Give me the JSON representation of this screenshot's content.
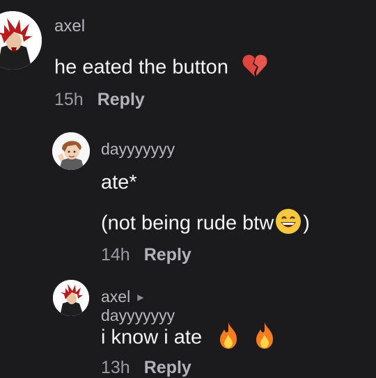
{
  "comments": [
    {
      "username": "axel",
      "text": "he eated the button",
      "emoji": "broken-heart-icon",
      "time": "15h",
      "reply_label": "Reply"
    },
    {
      "username": "dayyyyyyy",
      "line1": "ate*",
      "line2": "(not being rude btw",
      "line2_end": ")",
      "emoji": "grinning-face-icon",
      "time": "14h",
      "reply_label": "Reply"
    },
    {
      "username": "axel",
      "reply_to": "dayyyyyyy",
      "text": "i know i ate",
      "emoji": "fire-icon",
      "time": "13h",
      "reply_label": "Reply"
    }
  ]
}
